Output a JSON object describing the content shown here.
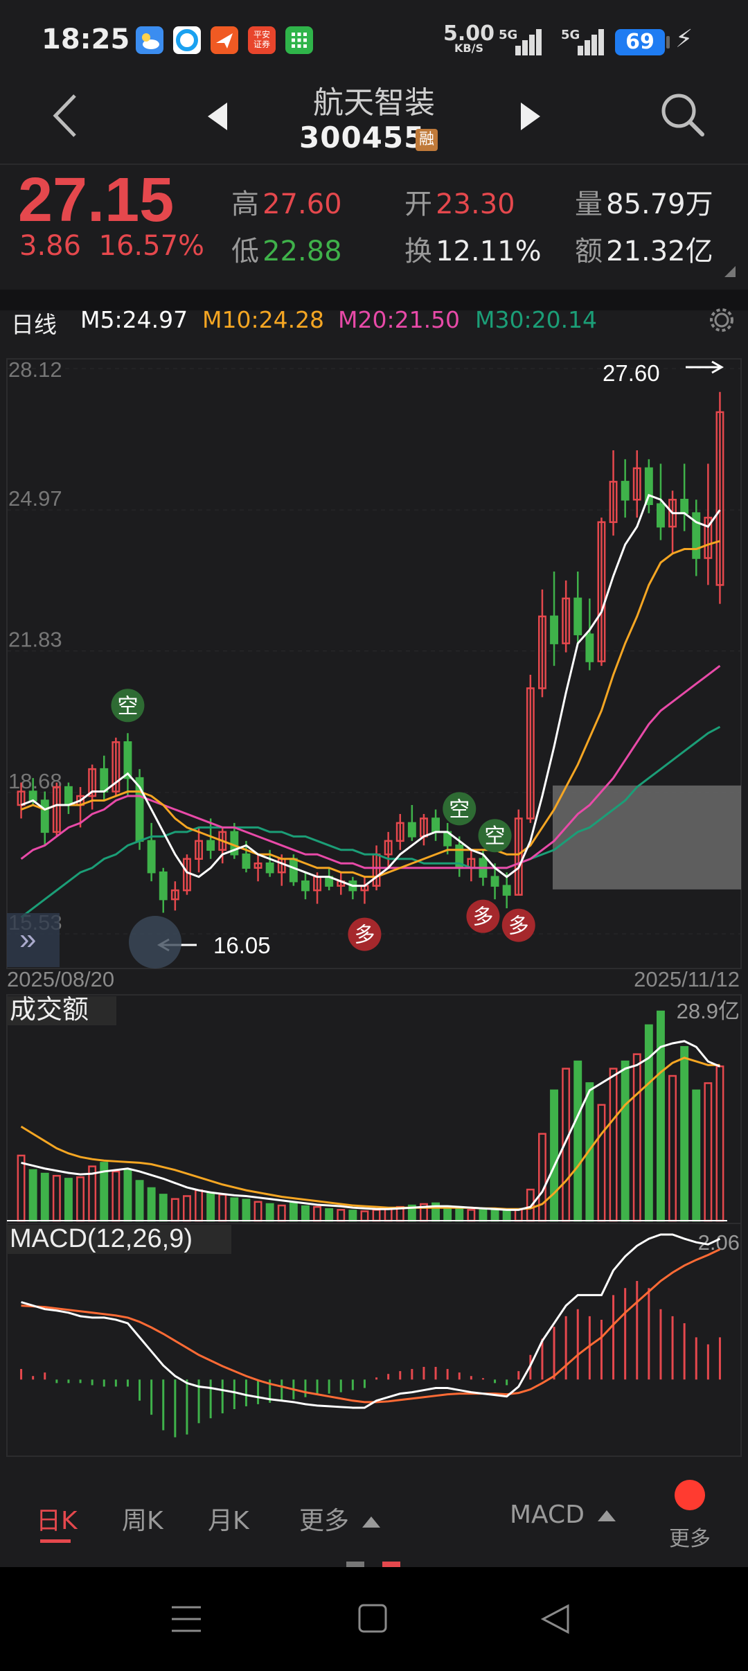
{
  "status": {
    "time": "18:25",
    "net_rate": "5.00",
    "net_unit": "KB/S",
    "sim1": "5G",
    "sim2": "5G",
    "battery": "69",
    "app_icons": [
      {
        "name": "weather-app-icon",
        "color": "#3b8df0"
      },
      {
        "name": "browser-app-icon",
        "color": "#1aa1f0"
      },
      {
        "name": "paper-plane-app-icon",
        "color": "#f05a23"
      },
      {
        "name": "securities-app-icon",
        "color": "#e8452c",
        "text": "平安证券"
      },
      {
        "name": "grid-app-icon",
        "color": "#2fb44a"
      }
    ]
  },
  "header": {
    "name": "航天智装",
    "code": "300455",
    "badge": "融"
  },
  "quote": {
    "price": "27.15",
    "change": "3.86",
    "change_pct": "16.57%",
    "high_label": "高",
    "high": "27.60",
    "low_label": "低",
    "low": "22.88",
    "open_label": "开",
    "open": "23.30",
    "turnover_label": "换",
    "turnover": "12.11%",
    "volume_label": "量",
    "volume": "85.79万",
    "amount_label": "额",
    "amount": "21.32亿"
  },
  "ma": {
    "period_label": "日线",
    "m5": "M5:24.97",
    "m10": "M10:24.28",
    "m20": "M20:21.50",
    "m30": "M30:20.14",
    "colors": {
      "m5": "#ffffff",
      "m10": "#f5a623",
      "m20": "#e84aa8",
      "m30": "#1b9e77"
    }
  },
  "chart_data": [
    {
      "type": "candlestick",
      "title": "",
      "y_ticks": [
        "28.12",
        "24.97",
        "21.83",
        "18.68",
        "15.53"
      ],
      "ylim": [
        15.53,
        28.12
      ],
      "date_start": "2025/08/20",
      "date_end": "2025/11/12",
      "max_label": "27.60",
      "min_label": "16.05",
      "markers": [
        {
          "label": "空",
          "index": 9,
          "kind": "short"
        },
        {
          "label": "多",
          "index": 29,
          "kind": "long"
        },
        {
          "label": "空",
          "index": 37,
          "kind": "short"
        },
        {
          "label": "空",
          "index": 40,
          "kind": "short"
        },
        {
          "label": "多",
          "index": 39,
          "kind": "long"
        },
        {
          "label": "多",
          "index": 42,
          "kind": "long"
        }
      ],
      "candles": [
        [
          18.4,
          18.9,
          18.1,
          18.7
        ],
        [
          18.7,
          19.0,
          18.4,
          18.5
        ],
        [
          18.5,
          18.7,
          17.5,
          17.8
        ],
        [
          17.8,
          18.9,
          17.7,
          18.8
        ],
        [
          18.8,
          18.9,
          18.2,
          18.4
        ],
        [
          18.4,
          18.8,
          17.9,
          18.6
        ],
        [
          18.6,
          19.3,
          18.3,
          19.2
        ],
        [
          19.2,
          19.5,
          18.5,
          18.7
        ],
        [
          18.7,
          19.9,
          18.6,
          19.8
        ],
        [
          19.8,
          20.0,
          18.6,
          19.0
        ],
        [
          19.0,
          19.2,
          17.4,
          17.6
        ],
        [
          17.6,
          18.0,
          16.7,
          16.9
        ],
        [
          16.9,
          17.0,
          16.0,
          16.3
        ],
        [
          16.3,
          16.7,
          16.05,
          16.5
        ],
        [
          16.5,
          17.3,
          16.4,
          17.2
        ],
        [
          17.2,
          17.9,
          16.9,
          17.6
        ],
        [
          17.6,
          18.1,
          17.2,
          17.4
        ],
        [
          17.4,
          17.9,
          17.1,
          17.8
        ],
        [
          17.8,
          18.0,
          17.2,
          17.3
        ],
        [
          17.3,
          17.6,
          16.9,
          17.0
        ],
        [
          17.0,
          17.3,
          16.7,
          17.1
        ],
        [
          17.1,
          17.4,
          16.8,
          16.9
        ],
        [
          16.9,
          17.3,
          16.6,
          17.2
        ],
        [
          17.2,
          17.3,
          16.6,
          16.7
        ],
        [
          16.7,
          16.9,
          16.3,
          16.5
        ],
        [
          16.5,
          16.9,
          16.2,
          16.8
        ],
        [
          16.8,
          17.0,
          16.5,
          16.6
        ],
        [
          16.6,
          16.9,
          16.4,
          16.7
        ],
        [
          16.7,
          16.8,
          16.3,
          16.5
        ],
        [
          16.5,
          16.8,
          16.2,
          16.6
        ],
        [
          16.6,
          17.5,
          16.5,
          17.3
        ],
        [
          17.3,
          17.8,
          17.0,
          17.6
        ],
        [
          17.6,
          18.2,
          17.4,
          18.0
        ],
        [
          18.0,
          18.4,
          17.6,
          17.7
        ],
        [
          17.7,
          18.2,
          17.5,
          18.1
        ],
        [
          18.1,
          18.3,
          17.6,
          17.8
        ],
        [
          17.8,
          18.0,
          17.3,
          17.5
        ],
        [
          17.5,
          17.7,
          16.8,
          17.0
        ],
        [
          17.0,
          17.4,
          16.7,
          17.2
        ],
        [
          17.2,
          17.4,
          16.6,
          16.8
        ],
        [
          16.8,
          17.1,
          16.3,
          16.6
        ],
        [
          16.6,
          16.9,
          16.1,
          16.4
        ],
        [
          16.4,
          18.3,
          16.4,
          18.1
        ],
        [
          18.1,
          21.3,
          18.0,
          21.0
        ],
        [
          21.0,
          23.2,
          20.8,
          22.6
        ],
        [
          22.6,
          23.6,
          21.5,
          22.0
        ],
        [
          22.0,
          23.4,
          21.8,
          23.0
        ],
        [
          23.0,
          23.6,
          22.0,
          22.2
        ],
        [
          22.2,
          23.0,
          21.4,
          21.6
        ],
        [
          21.6,
          24.8,
          21.5,
          24.7
        ],
        [
          24.7,
          26.3,
          24.4,
          25.6
        ],
        [
          25.6,
          26.1,
          24.8,
          25.2
        ],
        [
          25.2,
          26.3,
          24.8,
          25.9
        ],
        [
          25.9,
          26.1,
          24.9,
          25.1
        ],
        [
          25.1,
          26.0,
          24.3,
          24.6
        ],
        [
          24.6,
          25.4,
          24.0,
          25.2
        ],
        [
          25.2,
          26.0,
          24.5,
          24.9
        ],
        [
          24.9,
          25.2,
          23.5,
          23.9
        ],
        [
          23.9,
          26.0,
          23.3,
          24.8
        ],
        [
          23.3,
          27.6,
          22.88,
          27.15
        ]
      ],
      "ma": {
        "m5": [
          18.4,
          18.5,
          18.3,
          18.4,
          18.4,
          18.5,
          18.7,
          18.7,
          18.9,
          19.1,
          18.8,
          18.3,
          17.8,
          17.3,
          16.9,
          16.8,
          17.0,
          17.3,
          17.4,
          17.5,
          17.3,
          17.2,
          17.1,
          17.0,
          16.9,
          16.8,
          16.8,
          16.7,
          16.6,
          16.6,
          16.8,
          17.0,
          17.3,
          17.5,
          17.7,
          17.8,
          17.8,
          17.6,
          17.4,
          17.3,
          17.0,
          16.8,
          17.0,
          17.6,
          18.6,
          19.7,
          20.9,
          22.0,
          22.3,
          22.7,
          23.5,
          24.2,
          24.6,
          25.3,
          25.2,
          24.9,
          24.9,
          24.7,
          24.6,
          24.97
        ],
        "m10": [
          18.3,
          18.4,
          18.3,
          18.4,
          18.4,
          18.4,
          18.5,
          18.5,
          18.6,
          18.7,
          18.7,
          18.6,
          18.4,
          18.1,
          17.9,
          17.8,
          17.7,
          17.6,
          17.5,
          17.4,
          17.3,
          17.3,
          17.2,
          17.2,
          17.1,
          17.0,
          17.0,
          16.9,
          16.9,
          16.8,
          16.8,
          16.9,
          17.0,
          17.1,
          17.2,
          17.3,
          17.4,
          17.4,
          17.4,
          17.4,
          17.4,
          17.3,
          17.3,
          17.5,
          17.9,
          18.3,
          18.8,
          19.3,
          19.9,
          20.5,
          21.3,
          22.0,
          22.6,
          23.3,
          23.8,
          24.0,
          24.1,
          24.1,
          24.2,
          24.28
        ],
        "m20": [
          17.2,
          17.4,
          17.5,
          17.7,
          17.9,
          18.0,
          18.2,
          18.3,
          18.5,
          18.6,
          18.6,
          18.5,
          18.4,
          18.3,
          18.2,
          18.1,
          18.0,
          17.9,
          17.9,
          17.8,
          17.7,
          17.6,
          17.5,
          17.4,
          17.3,
          17.3,
          17.2,
          17.1,
          17.1,
          17.0,
          17.0,
          17.0,
          17.0,
          17.0,
          17.0,
          17.0,
          17.0,
          17.0,
          17.0,
          17.0,
          17.0,
          17.0,
          17.1,
          17.2,
          17.4,
          17.6,
          17.9,
          18.2,
          18.4,
          18.7,
          19.0,
          19.4,
          19.8,
          20.2,
          20.5,
          20.7,
          20.9,
          21.1,
          21.3,
          21.5
        ],
        "m30": [
          15.9,
          16.1,
          16.3,
          16.5,
          16.7,
          16.9,
          17.0,
          17.2,
          17.3,
          17.5,
          17.6,
          17.7,
          17.7,
          17.8,
          17.8,
          17.9,
          17.9,
          17.9,
          17.9,
          17.9,
          17.9,
          17.8,
          17.8,
          17.7,
          17.7,
          17.6,
          17.5,
          17.4,
          17.4,
          17.3,
          17.3,
          17.2,
          17.2,
          17.2,
          17.1,
          17.1,
          17.1,
          17.1,
          17.0,
          17.0,
          17.0,
          17.0,
          17.1,
          17.2,
          17.3,
          17.4,
          17.6,
          17.8,
          17.9,
          18.1,
          18.3,
          18.5,
          18.8,
          19.0,
          19.2,
          19.4,
          19.6,
          19.8,
          20.0,
          20.14
        ]
      }
    },
    {
      "type": "bar",
      "title": "成交额",
      "unit": "亿",
      "max_label": "28.9亿",
      "ylim": [
        0,
        28.9
      ],
      "values": [
        9,
        7,
        6.5,
        6.2,
        5.8,
        6,
        7.5,
        8,
        6.8,
        7,
        5.5,
        4.5,
        3.6,
        3,
        3.4,
        4.2,
        3.8,
        3.6,
        3.1,
        2.9,
        2.6,
        2.3,
        2.1,
        2.4,
        2,
        1.9,
        1.6,
        1.5,
        1.4,
        1.3,
        1.5,
        1.7,
        1.9,
        2.1,
        2.3,
        2.4,
        2,
        1.8,
        1.5,
        1.7,
        1.4,
        1.3,
        1.6,
        4.3,
        12,
        18,
        21,
        22,
        19,
        16,
        21,
        22,
        23,
        27,
        28.9,
        20,
        24,
        18,
        19,
        21.32
      ],
      "ma": {
        "white": [
          8,
          7.6,
          7.2,
          6.9,
          6.6,
          6.4,
          6.5,
          6.8,
          7,
          7.2,
          6.8,
          6.3,
          5.8,
          5.2,
          4.6,
          4.2,
          3.9,
          3.7,
          3.5,
          3.4,
          3.2,
          3,
          2.8,
          2.6,
          2.4,
          2.2,
          2.1,
          2,
          1.8,
          1.7,
          1.6,
          1.6,
          1.7,
          1.8,
          1.9,
          2,
          2,
          1.9,
          1.8,
          1.7,
          1.6,
          1.5,
          1.5,
          1.9,
          4,
          7.5,
          11,
          14.5,
          18,
          19,
          20,
          21,
          21.5,
          22.5,
          24,
          24.5,
          24.8,
          24,
          22,
          21.3
        ],
        "orange": [
          13,
          12,
          11,
          10,
          9.3,
          8.8,
          8.5,
          8.3,
          8.2,
          8.1,
          8,
          7.8,
          7.4,
          7,
          6.5,
          6,
          5.5,
          5,
          4.6,
          4.2,
          3.9,
          3.6,
          3.3,
          3.1,
          2.9,
          2.7,
          2.5,
          2.3,
          2.1,
          2,
          1.9,
          1.8,
          1.8,
          1.8,
          1.8,
          1.8,
          1.8,
          1.8,
          1.8,
          1.7,
          1.7,
          1.6,
          1.6,
          1.7,
          2.3,
          3.8,
          5.5,
          7.5,
          9.8,
          12,
          14,
          16,
          17.5,
          19,
          20.5,
          21.8,
          22.5,
          22,
          21.5,
          21.5
        ]
      }
    },
    {
      "type": "bar",
      "title": "MACD(12,26,9)",
      "max_label": "2.06",
      "ylim": [
        -1.05,
        2.06
      ],
      "hist": [
        0.15,
        0.05,
        0.1,
        -0.05,
        -0.05,
        -0.05,
        -0.08,
        -0.1,
        -0.1,
        -0.1,
        -0.3,
        -0.5,
        -0.72,
        -0.82,
        -0.78,
        -0.62,
        -0.55,
        -0.48,
        -0.42,
        -0.38,
        -0.35,
        -0.33,
        -0.3,
        -0.28,
        -0.25,
        -0.22,
        -0.2,
        -0.18,
        -0.15,
        -0.12,
        0.03,
        0.08,
        0.12,
        0.15,
        0.18,
        0.18,
        0.15,
        0.1,
        0.05,
        0.02,
        -0.05,
        -0.08,
        0.12,
        0.35,
        0.58,
        0.75,
        0.9,
        1.0,
        0.9,
        0.85,
        1.2,
        1.3,
        1.4,
        1.3,
        1.0,
        0.9,
        0.8,
        0.6,
        0.5,
        0.6
      ],
      "dif": [
        1.1,
        1.05,
        1.0,
        0.98,
        0.95,
        0.9,
        0.88,
        0.88,
        0.85,
        0.8,
        0.6,
        0.4,
        0.2,
        0.05,
        -0.05,
        -0.1,
        -0.12,
        -0.15,
        -0.18,
        -0.22,
        -0.25,
        -0.28,
        -0.3,
        -0.32,
        -0.35,
        -0.37,
        -0.38,
        -0.39,
        -0.4,
        -0.4,
        -0.3,
        -0.25,
        -0.2,
        -0.18,
        -0.15,
        -0.12,
        -0.12,
        -0.15,
        -0.18,
        -0.2,
        -0.22,
        -0.24,
        -0.1,
        0.2,
        0.55,
        0.8,
        1.05,
        1.2,
        1.2,
        1.2,
        1.55,
        1.75,
        1.9,
        2.0,
        2.06,
        2.06,
        2.0,
        1.95,
        1.92,
        2.0
      ],
      "dea": [
        1.05,
        1.04,
        1.03,
        1.01,
        0.99,
        0.97,
        0.95,
        0.93,
        0.91,
        0.88,
        0.82,
        0.74,
        0.65,
        0.55,
        0.45,
        0.35,
        0.27,
        0.19,
        0.12,
        0.05,
        -0.01,
        -0.06,
        -0.1,
        -0.14,
        -0.18,
        -0.21,
        -0.24,
        -0.27,
        -0.3,
        -0.32,
        -0.32,
        -0.31,
        -0.29,
        -0.27,
        -0.25,
        -0.23,
        -0.21,
        -0.2,
        -0.2,
        -0.2,
        -0.2,
        -0.21,
        -0.19,
        -0.14,
        -0.05,
        0.05,
        0.2,
        0.35,
        0.48,
        0.6,
        0.78,
        0.95,
        1.1,
        1.25,
        1.4,
        1.52,
        1.62,
        1.7,
        1.77,
        1.85
      ]
    }
  ],
  "tabs": {
    "day": "日K",
    "week": "周K",
    "month": "月K",
    "more": "更多",
    "indicator": "MACD",
    "more_menu": "更多"
  }
}
